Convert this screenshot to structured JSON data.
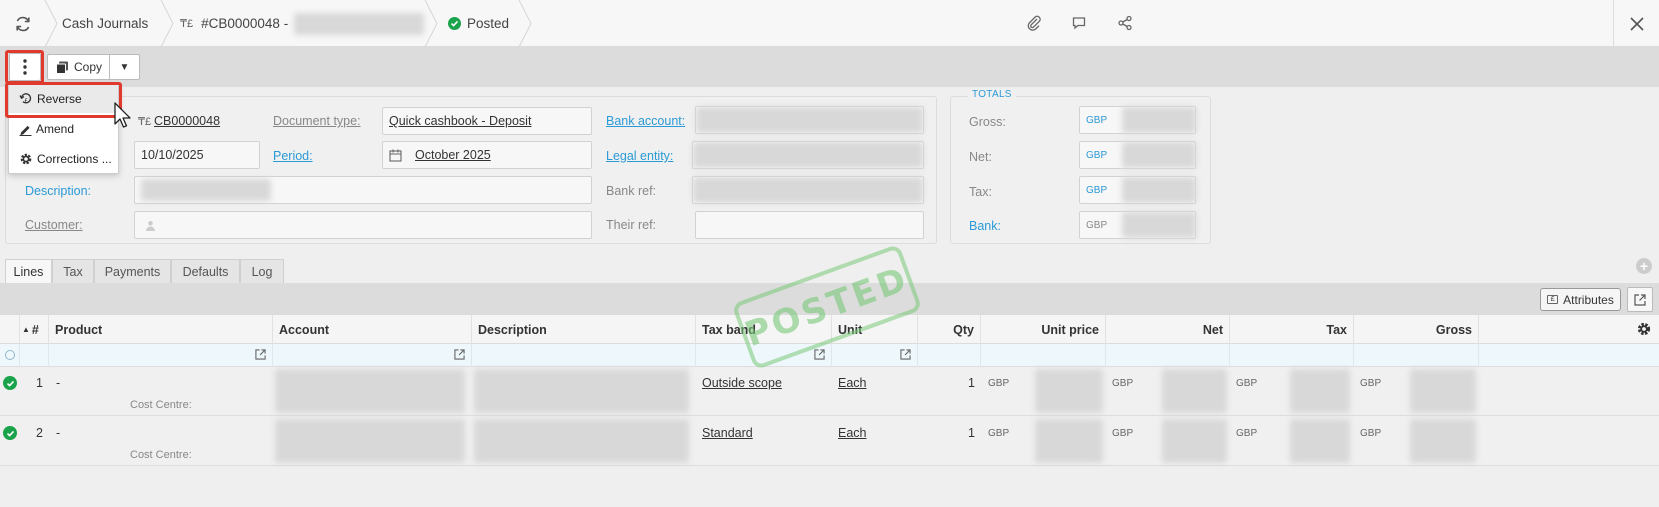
{
  "topbar": {
    "breadcrumb_module": "Cash Journals",
    "doc_ref": "#CB0000048 -",
    "status": "Posted"
  },
  "toolbar": {
    "copy_label": "Copy"
  },
  "menu": {
    "items": [
      "Reverse",
      "Amend",
      "Corrections ..."
    ]
  },
  "header": {
    "reference_value": "CB0000048",
    "date_value": "10/10/2025",
    "description_label": "Description:",
    "customer_label": "Customer:",
    "document_type_label": "Document type:",
    "document_type_value": "Quick cashbook - Deposit",
    "period_label": "Period:",
    "period_value": "October 2025",
    "bank_account_label": "Bank account:",
    "legal_entity_label": "Legal entity:",
    "bank_ref_label": "Bank ref:",
    "their_ref_label": "Their ref:"
  },
  "totals": {
    "legend": "TOTALS",
    "rows": [
      {
        "label": "Gross:",
        "currency": "GBP"
      },
      {
        "label": "Net:",
        "currency": "GBP"
      },
      {
        "label": "Tax:",
        "currency": "GBP"
      },
      {
        "label": "Bank:",
        "currency": "GBP"
      }
    ]
  },
  "tabs": [
    "Lines",
    "Tax",
    "Payments",
    "Defaults",
    "Log"
  ],
  "grid": {
    "attributes_label": "Attributes",
    "columns": [
      "#",
      "Product",
      "Account",
      "Description",
      "Tax band",
      "Unit",
      "Qty",
      "Unit price",
      "Net",
      "Tax",
      "Gross"
    ],
    "rows": [
      {
        "num": "1",
        "product": "-",
        "sub_label": "Cost Centre:",
        "tax_band": "Outside scope",
        "unit": "Each",
        "qty": "1",
        "currency": "GBP"
      },
      {
        "num": "2",
        "product": "-",
        "sub_label": "Cost Centre:",
        "tax_band": "Standard",
        "unit": "Each",
        "qty": "1",
        "currency": "GBP"
      }
    ]
  },
  "stamp": "POSTED",
  "colors": {
    "accent": "#2b9ad6",
    "highlight": "#e03a2e",
    "status_green": "#1aa34a"
  }
}
